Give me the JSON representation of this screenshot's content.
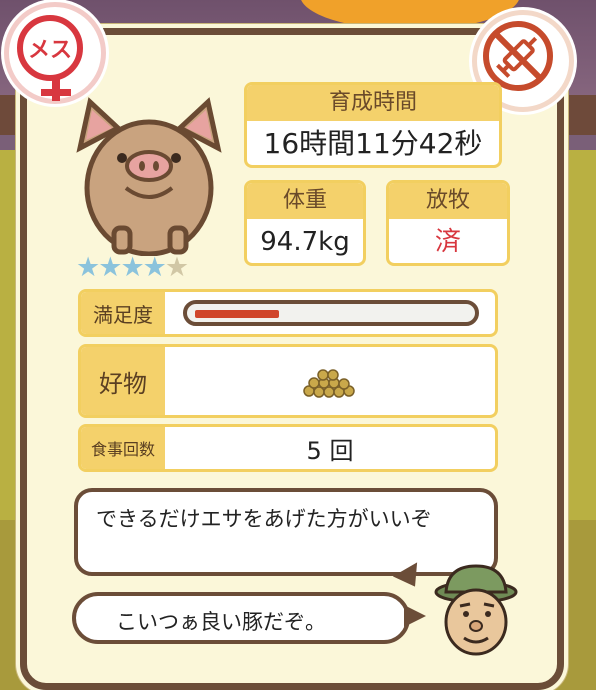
{
  "badges": {
    "female_label": "メス",
    "female_icon": "female-symbol-icon",
    "syringe_icon": "no-syringe-icon"
  },
  "stats": {
    "growth_time_label": "育成時間",
    "growth_time_value": "16時間11分42秒",
    "weight_label": "体重",
    "weight_value": "94.7kg",
    "grazing_label": "放牧",
    "grazing_value": "済"
  },
  "rating": {
    "filled": 4,
    "total": 5
  },
  "satisfaction": {
    "label": "満足度",
    "level": 0.31
  },
  "favorite": {
    "label": "好物",
    "icon": "grain-pile-icon"
  },
  "meals": {
    "label": "食事回数",
    "value": "5 回"
  },
  "dialogue": {
    "line1": "できるだけエサをあげた方がいいぞ",
    "line2": "こいつぁ良い豚だぞ。"
  },
  "colors": {
    "accent": "#f4d16b",
    "border": "#6b4d38",
    "alert": "#d8373f",
    "star": "#8bc3dc"
  }
}
